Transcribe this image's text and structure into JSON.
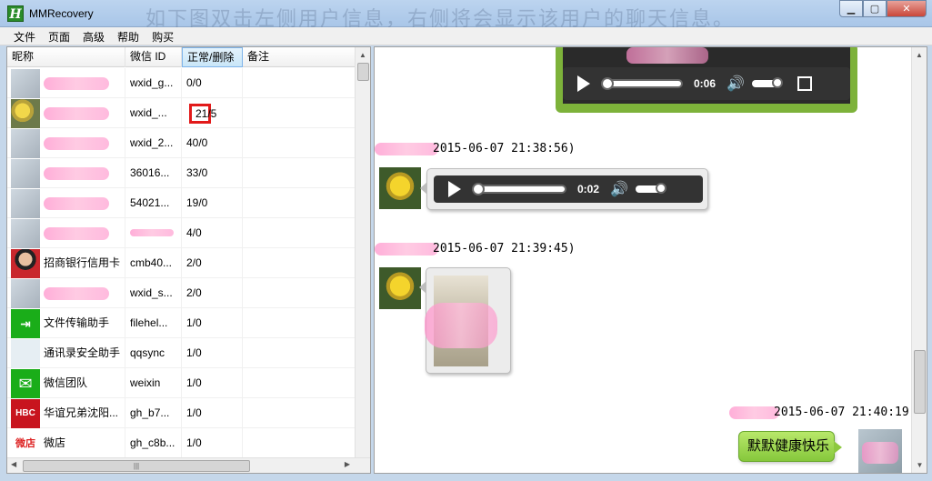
{
  "window": {
    "title": "MMRecovery",
    "watermark": "如下图双击左侧用户信息，右侧将会显示该用户的聊天信息。"
  },
  "menu": [
    "文件",
    "页面",
    "高级",
    "帮助",
    "购买"
  ],
  "table": {
    "columns": [
      "昵称",
      "微信 ID",
      "正常/删除",
      "备注"
    ],
    "rows": [
      {
        "name": "",
        "id": "wxid_g...",
        "count": "0/0",
        "note": ""
      },
      {
        "name": "",
        "id": "wxid_...",
        "count": "21/5",
        "note": ""
      },
      {
        "name": "",
        "id": "wxid_2...",
        "count": "40/0",
        "note": ""
      },
      {
        "name": "",
        "id": "36016...",
        "count": "33/0",
        "note": ""
      },
      {
        "name": "",
        "id": "54021...",
        "count": "19/0",
        "note": ""
      },
      {
        "name": "",
        "id": "",
        "count": "4/0",
        "note": ""
      },
      {
        "name": "招商银行信用卡",
        "id": "cmb40...",
        "count": "2/0",
        "note": ""
      },
      {
        "name": "",
        "id": "wxid_s...",
        "count": "2/0",
        "note": ""
      },
      {
        "name": "文件传输助手",
        "id": "filehel...",
        "count": "1/0",
        "note": ""
      },
      {
        "name": "通讯录安全助手",
        "id": "qqsync",
        "count": "1/0",
        "note": ""
      },
      {
        "name": "微信团队",
        "id": "weixin",
        "count": "1/0",
        "note": ""
      },
      {
        "name": "华谊兄弟沈阳...",
        "id": "gh_b7...",
        "count": "1/0",
        "note": ""
      },
      {
        "name": "微店",
        "id": "gh_c8b...",
        "count": "1/0",
        "note": ""
      }
    ]
  },
  "chat": {
    "video_time": "0:06",
    "ts1": "2015-06-07 21:38:56)",
    "voice_time": "0:02",
    "ts2": "2015-06-07 21:39:45)",
    "ts3": "2015-06-07 21:40:19)",
    "message": "默默健康快乐"
  },
  "icons": {
    "play": "play-icon",
    "volume": "volume-icon",
    "fullscreen": "fullscreen-icon"
  },
  "colors": {
    "accent_green": "#86c83c",
    "highlight_red": "#e21a1a"
  }
}
